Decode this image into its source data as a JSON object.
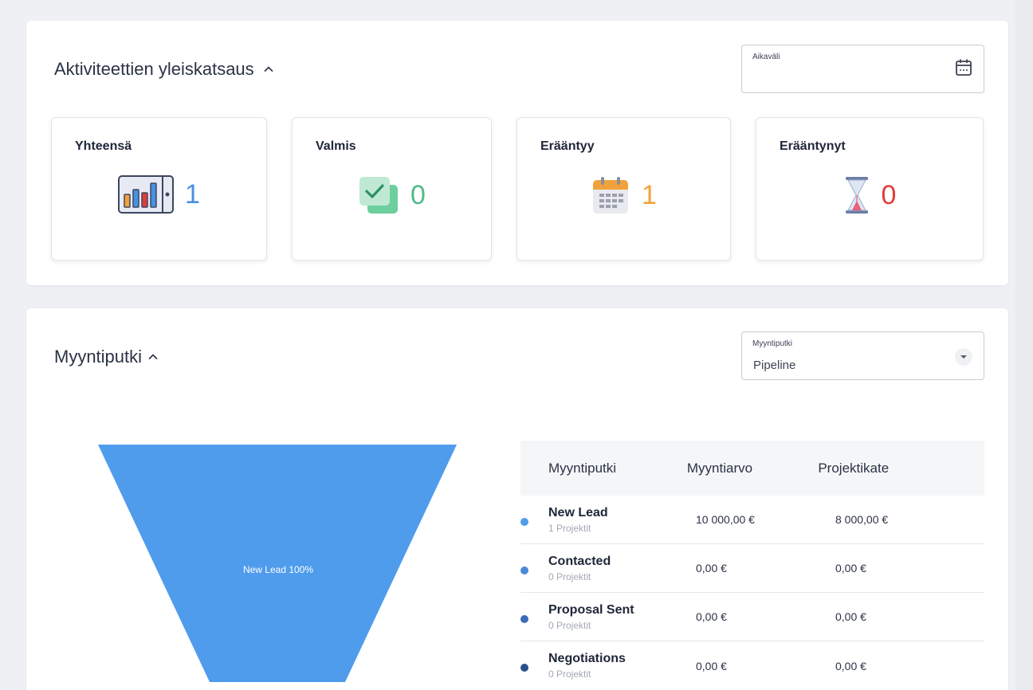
{
  "activities": {
    "title": "Aktiviteettien yleiskatsaus",
    "date_range": {
      "label": "Aikaväli",
      "value": ""
    },
    "cards": [
      {
        "title": "Yhteensä",
        "value": "1",
        "color": "#4a90e2",
        "icon": "bar-chart-icon"
      },
      {
        "title": "Valmis",
        "value": "0",
        "color": "#4fba8a",
        "icon": "checkbox-icon"
      },
      {
        "title": "Erääntyy",
        "value": "1",
        "color": "#f2a23a",
        "icon": "calendar-icon"
      },
      {
        "title": "Erääntynyt",
        "value": "0",
        "color": "#e23b3b",
        "icon": "hourglass-icon"
      }
    ]
  },
  "pipeline": {
    "title": "Myyntiputki",
    "select": {
      "label": "Myyntiputki",
      "value": "Pipeline"
    },
    "funnel_label": "New Lead 100%",
    "funnel_color": "#4f9ced",
    "table": {
      "headers": [
        "Myyntiputki",
        "Myyntiarvo",
        "Projektikate"
      ],
      "rows": [
        {
          "name": "New Lead",
          "sub": "1 Projektit",
          "value": "10 000,00 €",
          "margin": "8 000,00 €",
          "dot": "#4f9ced"
        },
        {
          "name": "Contacted",
          "sub": "0 Projektit",
          "value": "0,00 €",
          "margin": "0,00 €",
          "dot": "#4a8ad8"
        },
        {
          "name": "Proposal Sent",
          "sub": "0 Projektit",
          "value": "0,00 €",
          "margin": "0,00 €",
          "dot": "#3a6db8"
        },
        {
          "name": "Negotiations",
          "sub": "0 Projektit",
          "value": "0,00 €",
          "margin": "0,00 €",
          "dot": "#2b4f8e"
        }
      ]
    }
  }
}
